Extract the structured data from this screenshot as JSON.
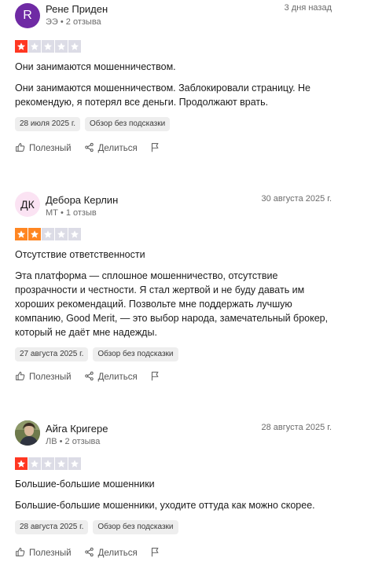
{
  "colors": {
    "star_filled_1": "#ff3722",
    "star_filled_2": "#ff8622",
    "star_empty": "#dcdce6",
    "avatar1_bg": "#6f2aa4",
    "avatar2_bg": "#fbe3f3"
  },
  "reviews": [
    {
      "name": "Рене Приден",
      "meta": "ЭЭ • 2 отзыва",
      "date": "3 дня назад",
      "avatar_text": "R",
      "rating": 1,
      "title": "Они занимаются мошенничеством.",
      "body": "Они занимаются мошенничеством. Заблокировали страницу. Не рекомендую, я потерял все деньги. Продолжают врать.",
      "tag_date": "28 июля 2025 г.",
      "tag_type": "Обзор без подсказки",
      "useful": "Полезный",
      "share": "Делиться"
    },
    {
      "name": "Дебора Керлин",
      "meta": "МТ • 1 отзыв",
      "date": "30 августа 2025 г.",
      "avatar_text": "ДК",
      "rating": 2,
      "title": "Отсутствие ответственности",
      "body": "Эта платформа — сплошное мошенничество, отсутствие прозрачности и честности. Я стал жертвой и не буду давать им хороших рекомендаций. Позвольте мне поддержать лучшую компанию, Good Merit, — это выбор народа, замечательный брокер, который не даёт мне надежды.",
      "tag_date": "27 августа 2025 г.",
      "tag_type": "Обзор без подсказки",
      "useful": "Полезный",
      "share": "Делиться"
    },
    {
      "name": "Айга Кригере",
      "meta": "ЛВ • 2 отзыва",
      "date": "28 августа 2025 г.",
      "avatar_text": "",
      "rating": 1,
      "title": "Большие-большие мошенники",
      "body": "Большие-большие мошенники, уходите оттуда как можно скорее.",
      "tag_date": "28 августа 2025 г.",
      "tag_type": "Обзор без подсказки",
      "useful": "Полезный",
      "share": "Делиться"
    }
  ]
}
